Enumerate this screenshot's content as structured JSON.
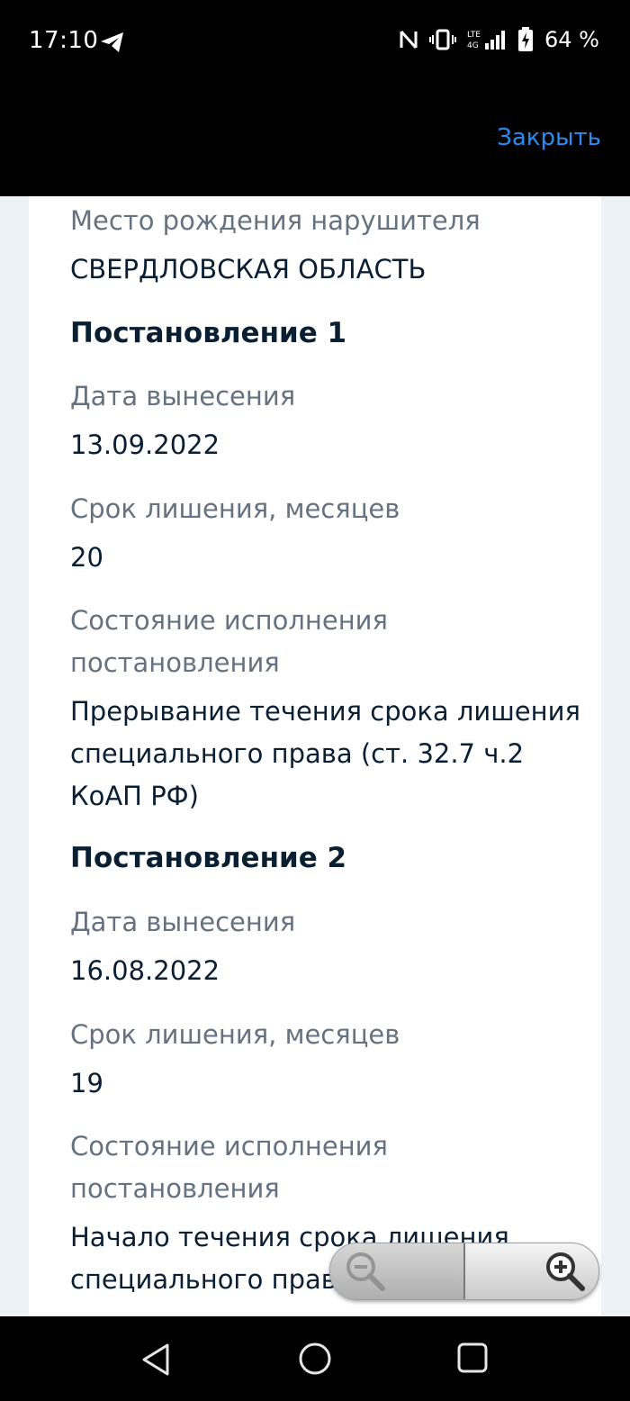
{
  "status_bar": {
    "time": "17:10",
    "battery_percent": "64 %",
    "icons": [
      "telegram-icon",
      "nfc-icon",
      "vibrate-icon",
      "lte-signal-icon",
      "battery-charging-icon"
    ]
  },
  "header": {
    "close_label": "Закрыть",
    "accent_color": "#2a8cf0"
  },
  "offender": {
    "birthplace_label": "Место рождения нарушителя",
    "birthplace_value": "СВЕРДЛОВСКАЯ ОБЛАСТЬ"
  },
  "rulings": [
    {
      "title": "Постановление 1",
      "date_label": "Дата вынесения",
      "date_value": "13.09.2022",
      "term_label": "Срок лишения, месяцев",
      "term_value": "20",
      "status_label_line1": "Состояние исполнения",
      "status_label_line2": "постановления",
      "status_value_line1": "Прерывание течения срока лишения",
      "status_value_line2": "специального права (ст. 32.7 ч.2",
      "status_value_line3": "КоАП РФ)"
    },
    {
      "title": "Постановление 2",
      "date_label": "Дата вынесения",
      "date_value": "16.08.2022",
      "term_label": "Срок лишения, месяцев",
      "term_value": "19",
      "status_label_line1": "Состояние исполнения",
      "status_label_line2": "постановления",
      "status_value_line1": "Начало течения срока лишения",
      "status_value_line2": "специального права"
    }
  ],
  "zoom_control": {
    "icons": [
      "zoom-out-icon",
      "zoom-in-icon"
    ]
  },
  "nav_bar": {
    "icons": [
      "back-icon",
      "home-icon",
      "recents-icon"
    ]
  }
}
